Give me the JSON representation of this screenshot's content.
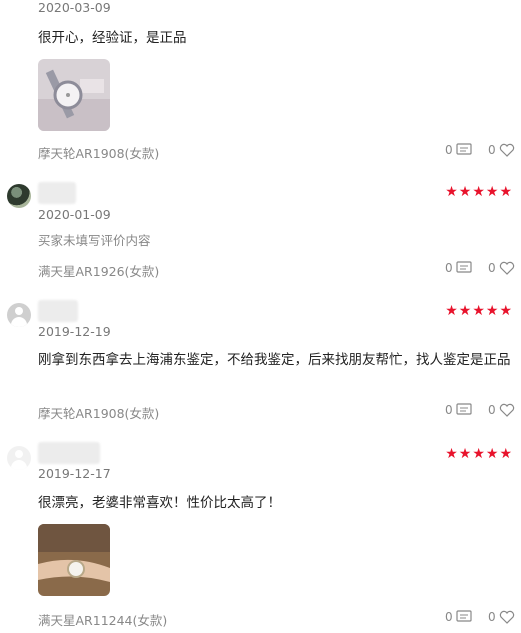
{
  "reviews": [
    {
      "date": "2020-03-09",
      "text": "很开心，经验证，是正品",
      "spec": "摩天轮AR1908(女款)",
      "comments": "0",
      "likes": "0",
      "stars": "★★★★★"
    },
    {
      "date": "2020-01-09",
      "text": "买家未填写评价内容",
      "spec": "满天星AR1926(女款)",
      "comments": "0",
      "likes": "0",
      "stars": "★★★★★"
    },
    {
      "date": "2019-12-19",
      "text": "刚拿到东西拿去上海浦东鉴定，不给我鉴定，后来找朋友帮忙，找人鉴定是正品",
      "spec": "摩天轮AR1908(女款)",
      "comments": "0",
      "likes": "0",
      "stars": "★★★★★"
    },
    {
      "date": "2019-12-17",
      "text": "很漂亮，老婆非常喜欢！性价比太高了！",
      "spec": "满天星AR11244(女款)",
      "comments": "0",
      "likes": "0",
      "stars": "★★★★★"
    }
  ],
  "colors": {
    "star": "#e8132c",
    "muted": "#888888"
  },
  "icons": {
    "comment": "comment-icon",
    "like": "heart-icon"
  }
}
